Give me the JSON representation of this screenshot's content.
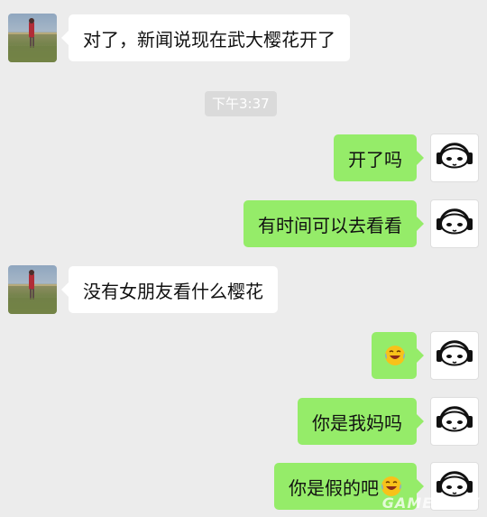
{
  "timestamp": "下午3:37",
  "messages": [
    {
      "side": "left",
      "text": "对了，新闻说现在武大樱花开了"
    },
    {
      "side": "right",
      "text": "开了吗"
    },
    {
      "side": "right",
      "text": "有时间可以去看看"
    },
    {
      "side": "left",
      "text": "没有女朋友看什么樱花"
    },
    {
      "side": "right",
      "text": "",
      "emoji": "laughing-crying-emoji"
    },
    {
      "side": "right",
      "text": "你是我妈吗"
    },
    {
      "side": "right",
      "text": "你是假的吧",
      "emoji": "laughing-crying-emoji"
    }
  ],
  "watermark": "GAMERSKY",
  "colors": {
    "background": "#ececec",
    "bubble_self": "#95ec69",
    "bubble_other": "#ffffff",
    "timestamp_bg": "#dadada",
    "timestamp_text": "#ffffff"
  }
}
